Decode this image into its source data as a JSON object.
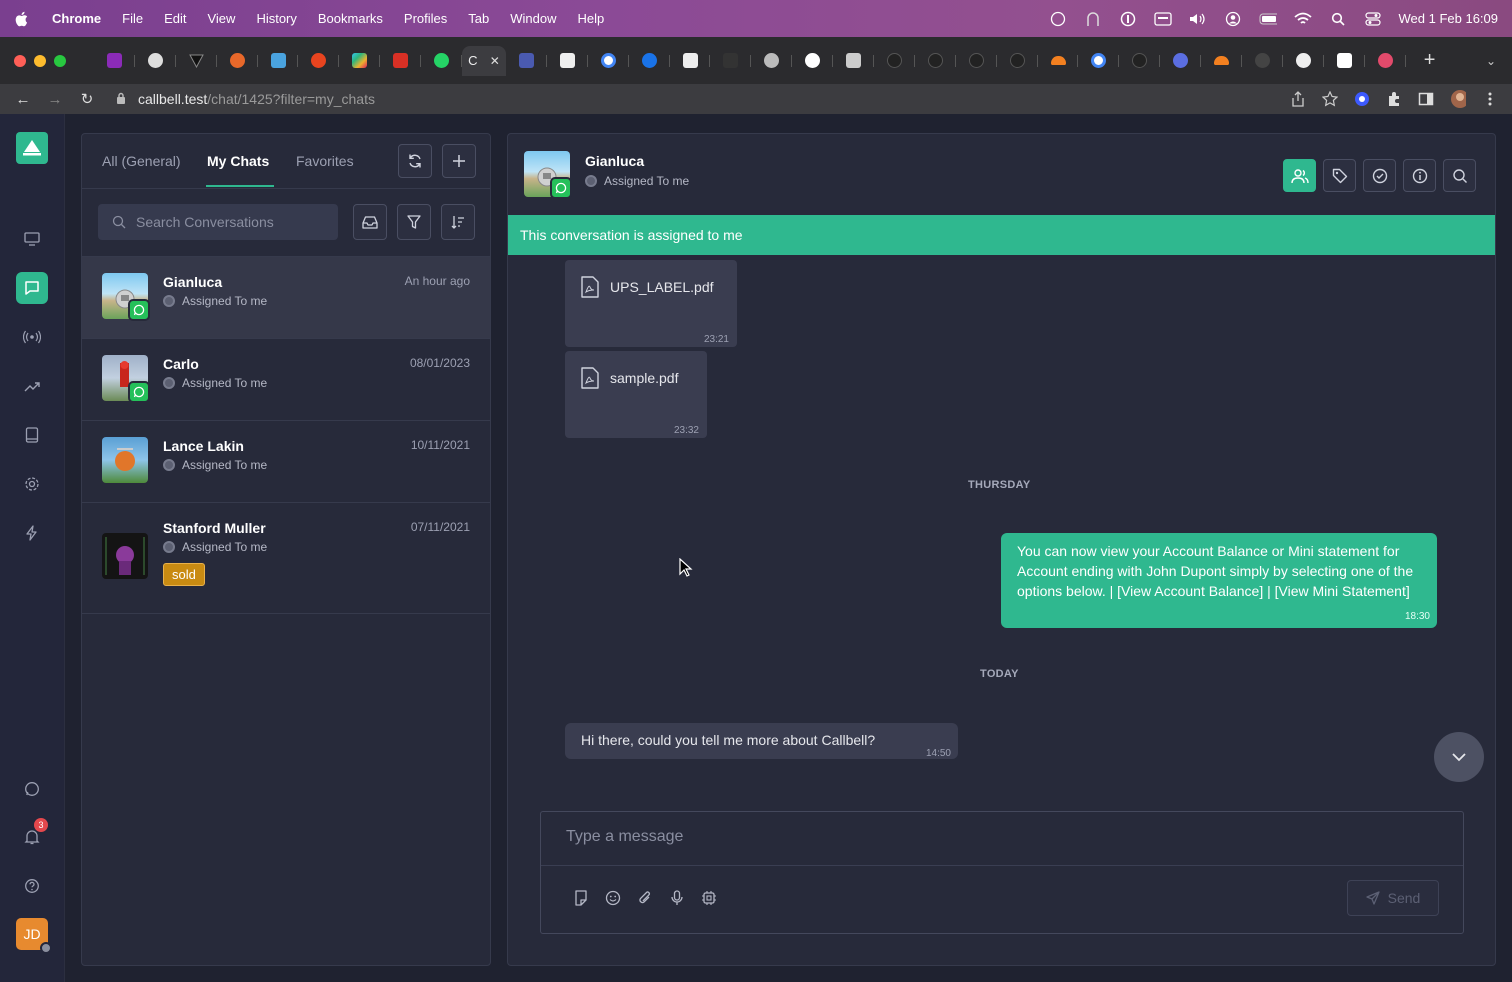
{
  "menubar": {
    "app_name": "Chrome",
    "items": [
      "File",
      "Edit",
      "View",
      "History",
      "Bookmarks",
      "Profiles",
      "Tab",
      "Window",
      "Help"
    ],
    "clock": "Wed 1 Feb  16:09"
  },
  "browser": {
    "active_tab_label": "C",
    "url_host": "callbell.test",
    "url_path": "/chat/1425?filter=my_chats"
  },
  "sidenav": {
    "notifications_count": "3",
    "user_initials": "JD"
  },
  "conversations": {
    "tabs": [
      "All (General)",
      "My Chats",
      "Favorites"
    ],
    "active_tab": "My Chats",
    "search_placeholder": "Search Conversations",
    "items": [
      {
        "name": "Gianluca",
        "status": "Assigned To me",
        "time": "An hour ago",
        "channel": "whatsapp",
        "selected": true
      },
      {
        "name": "Carlo",
        "status": "Assigned To me",
        "time": "08/01/2023",
        "channel": "whatsapp"
      },
      {
        "name": "Lance Lakin",
        "status": "Assigned To me",
        "time": "10/11/2021"
      },
      {
        "name": "Stanford Muller",
        "status": "Assigned To me",
        "time": "07/11/2021",
        "tag": "sold"
      }
    ]
  },
  "chat": {
    "contact_name": "Gianluca",
    "contact_status": "Assigned To me",
    "assigned_banner": "This conversation is assigned to me",
    "messages": [
      {
        "type": "file",
        "filename": "UPS_LABEL.pdf",
        "time": "23:21"
      },
      {
        "type": "file",
        "filename": "sample.pdf",
        "time": "23:32"
      },
      {
        "type": "separator",
        "label": "THURSDAY"
      },
      {
        "type": "outgoing",
        "text": "You can now view your Account Balance or Mini statement for Account ending with John Dupont simply by selecting one of the options below. | [View Account Balance] | [View Mini Statement]",
        "time": "18:30"
      },
      {
        "type": "separator",
        "label": "TODAY"
      },
      {
        "type": "incoming",
        "text": "Hi there, could you tell me more about Callbell?",
        "time": "14:50"
      }
    ],
    "composer_placeholder": "Type a message",
    "send_label": "Send"
  },
  "colors": {
    "accent": "#2fb88f",
    "whatsapp": "#25c05a",
    "tag_sold": "#c98b12",
    "background": "#1f2230",
    "panel": "#272a3a"
  }
}
